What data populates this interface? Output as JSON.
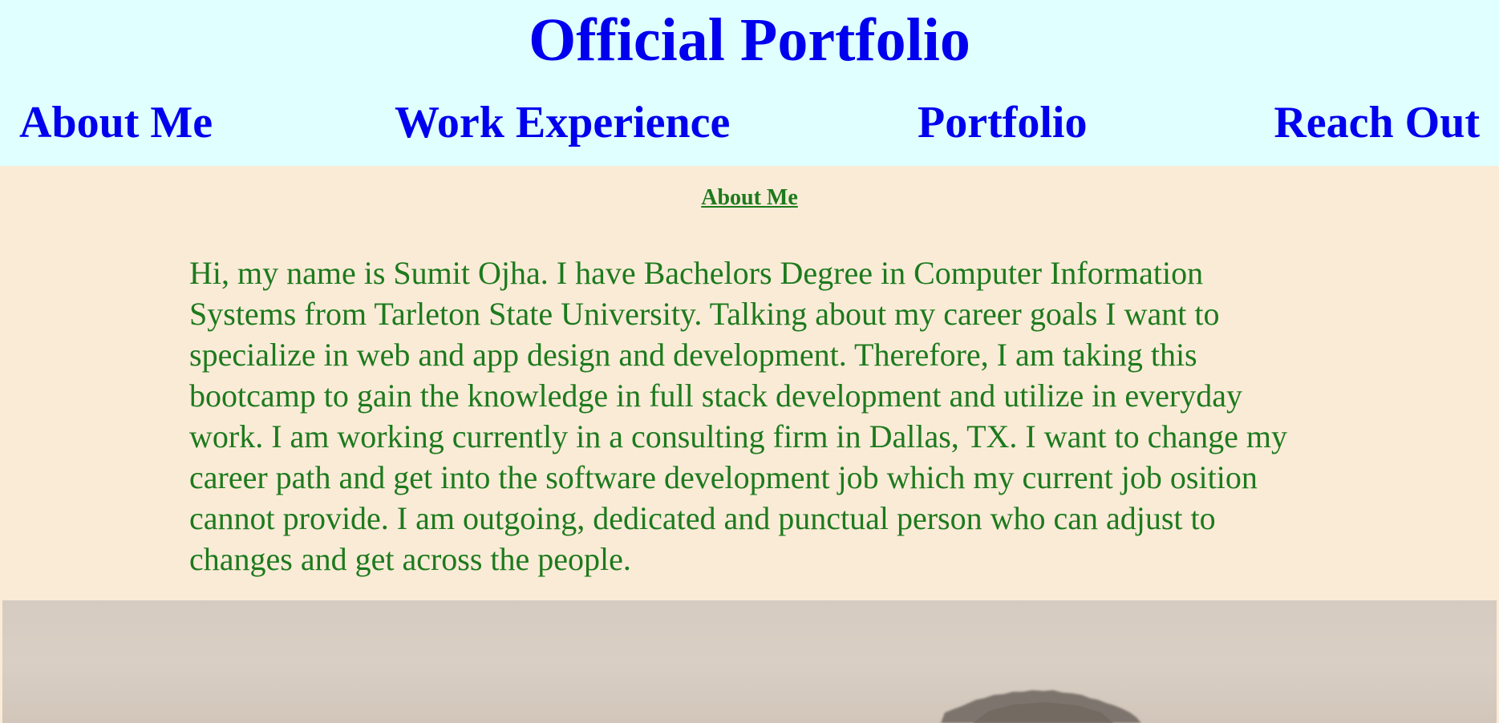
{
  "header": {
    "title": "Official Portfolio"
  },
  "nav": {
    "items": [
      {
        "label": "About Me"
      },
      {
        "label": "Work Experience"
      },
      {
        "label": "Portfolio"
      },
      {
        "label": "Reach Out"
      }
    ]
  },
  "about": {
    "heading": "About Me",
    "bio": "Hi, my name is Sumit Ojha. I have Bachelors Degree in Computer Information Systems from Tarleton State University. Talking about my career goals I want to specialize in web and app design and development. Therefore, I am taking this bootcamp to gain the knowledge in full stack development and utilize in everyday work. I am working currently in a consulting firm in Dallas, TX. I want to change my career path and get into the software development job which my current job osition cannot provide. I am outgoing, dedicated and punctual person who can adjust to changes and get across the people."
  },
  "colors": {
    "header_background": "#e0ffff",
    "page_background": "#faebd7",
    "nav_text": "#0000ee",
    "content_text": "#1d7a1d"
  }
}
